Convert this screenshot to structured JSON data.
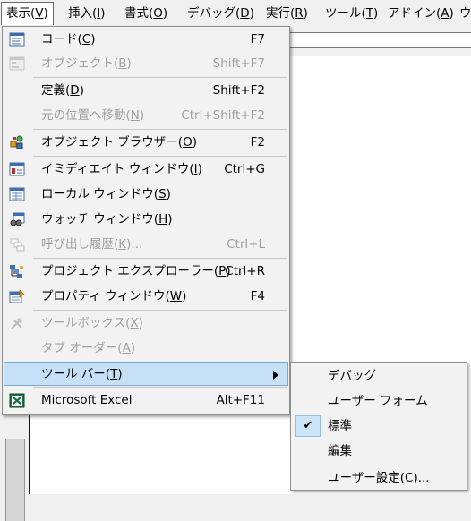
{
  "menubar": {
    "items": [
      {
        "label": "表示(",
        "key": "V",
        "suffix": ")"
      },
      {
        "label": "挿入(",
        "key": "I",
        "suffix": ")"
      },
      {
        "label": "書式(",
        "key": "O",
        "suffix": ")"
      },
      {
        "label": "デバッグ(",
        "key": "D",
        "suffix": ")"
      },
      {
        "label": "実行(",
        "key": "R",
        "suffix": ")"
      },
      {
        "label": "ツール(",
        "key": "T",
        "suffix": ")"
      },
      {
        "label": "アドイン(",
        "key": "A",
        "suffix": ")"
      },
      {
        "label": "ウ",
        "key": "",
        "suffix": ""
      }
    ]
  },
  "view_menu": {
    "items": [
      {
        "label": "コード(",
        "key": "C",
        "suffix": ")",
        "shortcut": "F7",
        "icon": "code-icon"
      },
      {
        "label": "オブジェクト(",
        "key": "B",
        "suffix": ")",
        "shortcut": "Shift+F7",
        "icon": "object-icon"
      },
      {
        "label": "定義(",
        "key": "D",
        "suffix": ")",
        "shortcut": "Shift+F2",
        "icon": ""
      },
      {
        "label": "元の位置へ移動(",
        "key": "N",
        "suffix": ")",
        "shortcut": "Ctrl+Shift+F2",
        "icon": ""
      },
      {
        "label": "オブジェクト ブラウザー(",
        "key": "O",
        "suffix": ")",
        "shortcut": "F2",
        "icon": "object-browser-icon"
      },
      {
        "label": "イミディエイト ウィンドウ(",
        "key": "I",
        "suffix": ")",
        "shortcut": "Ctrl+G",
        "icon": "immediate-window-icon"
      },
      {
        "label": "ローカル ウィンドウ(",
        "key": "S",
        "suffix": ")",
        "shortcut": "",
        "icon": "locals-window-icon"
      },
      {
        "label": "ウォッチ ウィンドウ(",
        "key": "H",
        "suffix": ")",
        "shortcut": "",
        "icon": "watch-window-icon"
      },
      {
        "label": "呼び出し履歴(",
        "key": "K",
        "suffix": ")...",
        "shortcut": "Ctrl+L",
        "icon": "call-stack-icon"
      },
      {
        "label": "プロジェクト エクスプローラー(",
        "key": "P",
        "suffix": ")",
        "shortcut": "Ctrl+R",
        "icon": "project-explorer-icon"
      },
      {
        "label": "プロパティ ウィンドウ(",
        "key": "W",
        "suffix": ")",
        "shortcut": "F4",
        "icon": "properties-window-icon"
      },
      {
        "label": "ツールボックス(",
        "key": "X",
        "suffix": ")",
        "shortcut": "",
        "icon": "toolbox-icon"
      },
      {
        "label": "タブ オーダー(",
        "key": "A",
        "suffix": ")",
        "shortcut": "",
        "icon": ""
      },
      {
        "label": "ツール バー(",
        "key": "T",
        "suffix": ")",
        "shortcut": "",
        "icon": ""
      },
      {
        "label": "Microsoft Excel",
        "key": "",
        "suffix": "",
        "shortcut": "Alt+F11",
        "icon": "excel-icon"
      }
    ]
  },
  "toolbar_submenu": {
    "items": [
      {
        "label": "デバッグ",
        "key": "",
        "suffix": "",
        "checked": false
      },
      {
        "label": "ユーザー フォーム",
        "key": "",
        "suffix": "",
        "checked": false
      },
      {
        "label": "標準",
        "key": "",
        "suffix": "",
        "checked": true
      },
      {
        "label": "編集",
        "key": "",
        "suffix": "",
        "checked": false
      },
      {
        "label": "ユーザー設定(",
        "key": "C",
        "suffix": ")...",
        "checked": false
      }
    ],
    "check_mark": "✔"
  },
  "colors": {
    "highlight": "#c5e0f7",
    "disabled_text": "#a0a0a0",
    "menu_bg": "#f2f2f2"
  }
}
